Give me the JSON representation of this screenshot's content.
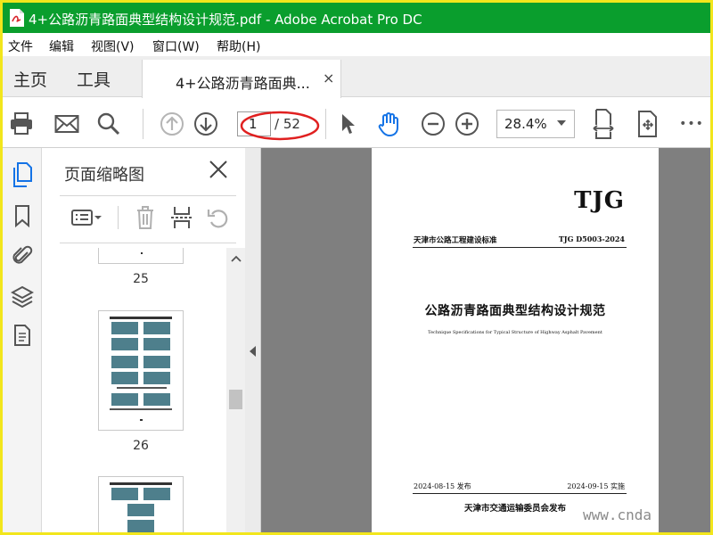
{
  "window": {
    "title": "4+公路沥青路面典型结构设计规范.pdf - Adobe Acrobat Pro DC",
    "border_color": "#f2e61c",
    "titlebar_color": "#0a9e2d"
  },
  "menu": {
    "items": [
      "文件",
      "编辑",
      "视图(V)",
      "窗口(W)",
      "帮助(H)"
    ]
  },
  "tabs": {
    "home": "主页",
    "tools": "工具",
    "document": "4+公路沥青路面典...",
    "close_glyph": "×"
  },
  "toolbar": {
    "icons": [
      "print-icon",
      "email-icon",
      "search-icon",
      "page-up-icon",
      "page-down-icon",
      "select-cursor-icon",
      "hand-tool-icon",
      "zoom-out-icon",
      "zoom-in-icon",
      "fit-width-icon",
      "rotate-view-icon",
      "more-icon"
    ],
    "page_current": "1",
    "page_total": "/ 52",
    "zoom": "28.4%",
    "more_label": "•••"
  },
  "side_panel": {
    "title": "页面缩略图",
    "thumbnails": [
      {
        "page": "25"
      },
      {
        "page": "26"
      }
    ]
  },
  "document": {
    "brand": "TJG",
    "header_left": "天津市公路工程建设标准",
    "header_right": "TJG D5003-2024",
    "main_title": "公路沥青路面典型结构设计规范",
    "subtitle": "Technique Specifications for Typical Structure of Highway Asphalt Pavement",
    "date_issue": "2024-08-15 发布",
    "date_effective": "2024-09-15 实施",
    "issuer": "天津市交通运输委员会发布"
  },
  "watermark": "www.cnda"
}
